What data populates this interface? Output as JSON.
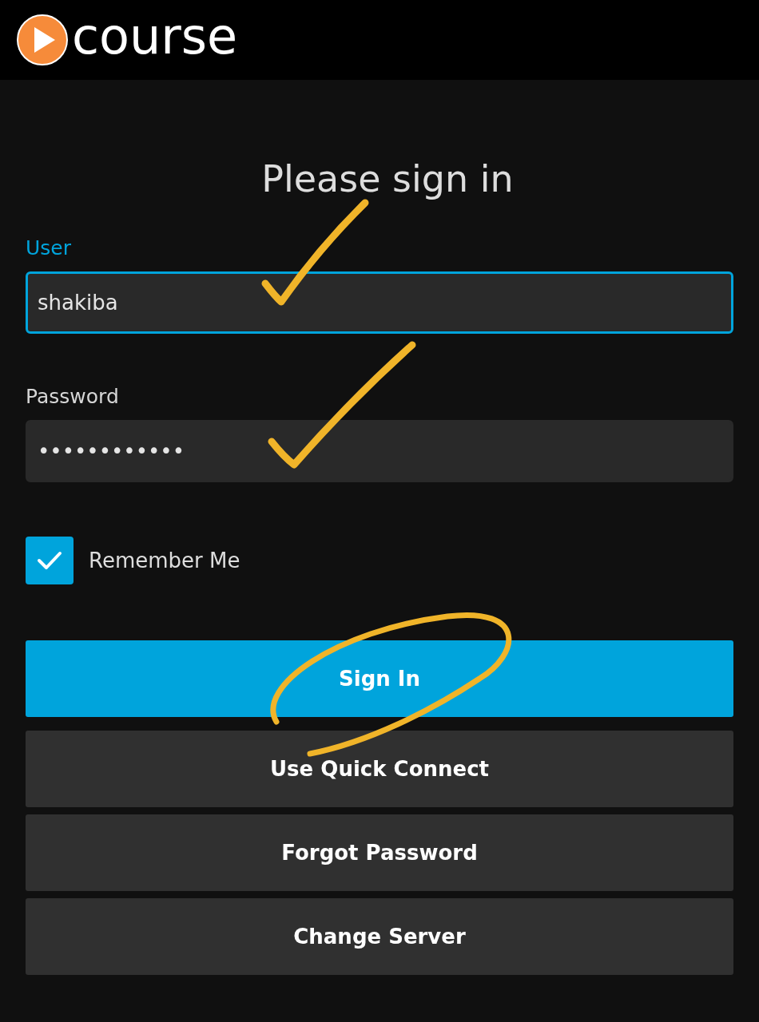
{
  "header": {
    "logo_text": "course"
  },
  "title": "Please sign in",
  "fields": [
    {
      "label": "User",
      "value": "shakiba",
      "focused": true
    },
    {
      "label": "Password",
      "value": "••••••••••••",
      "focused": false
    }
  ],
  "remember": {
    "label": "Remember Me",
    "checked": true
  },
  "buttons": [
    {
      "label": "Sign In",
      "kind": "primary"
    },
    {
      "label": "Use Quick Connect",
      "kind": "secondary"
    },
    {
      "label": "Forgot Password",
      "kind": "secondary"
    },
    {
      "label": "Change Server",
      "kind": "secondary"
    }
  ]
}
